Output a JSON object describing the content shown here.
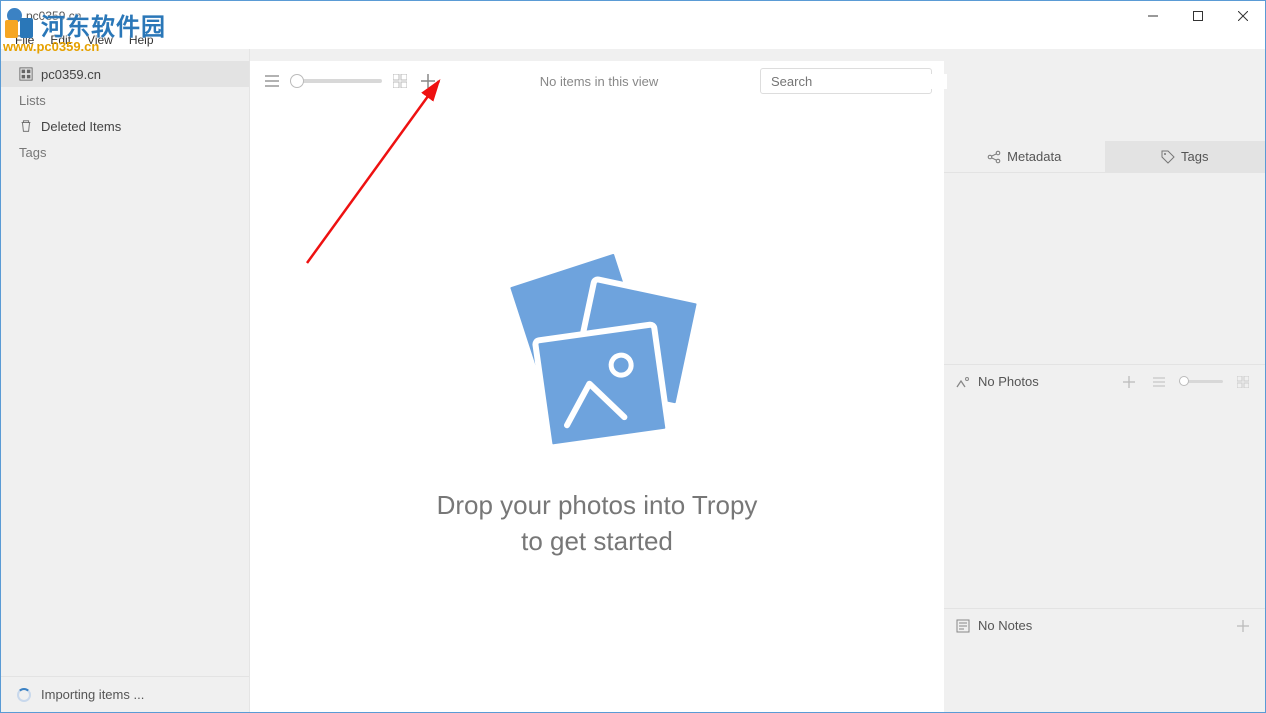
{
  "window": {
    "title": "pc0359.cn"
  },
  "menubar": [
    "File",
    "Edit",
    "View",
    "Help"
  ],
  "sidebar": {
    "project": "pc0359.cn",
    "lists_header": "Lists",
    "deleted": "Deleted Items",
    "tags_header": "Tags",
    "status": "Importing items ..."
  },
  "toolbar": {
    "center_text": "No items in this view",
    "search_placeholder": "Search"
  },
  "dropzone": {
    "line1": "Drop your photos into Tropy",
    "line2": "to get started"
  },
  "right": {
    "tab_metadata": "Metadata",
    "tab_tags": "Tags",
    "photos_header": "No Photos",
    "notes_header": "No Notes"
  },
  "watermark": {
    "text": "河东软件园",
    "url": "www.pc0359.cn"
  }
}
